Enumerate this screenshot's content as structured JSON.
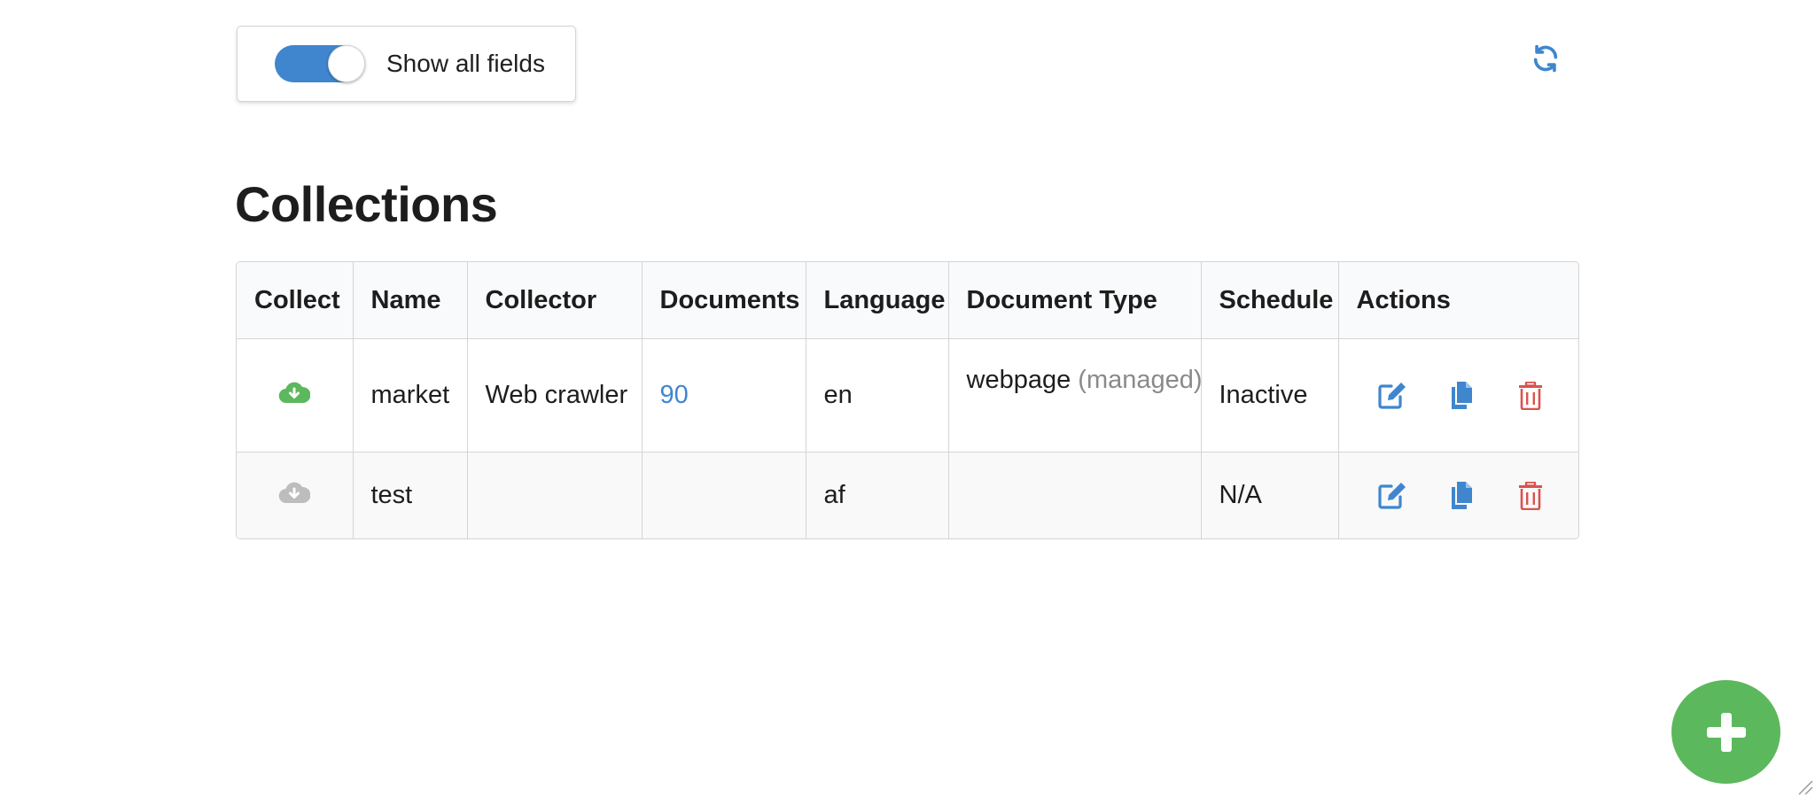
{
  "toggle": {
    "label": "Show all fields",
    "checked": true,
    "accent_color": "#3f86cf"
  },
  "refresh_icon": "refresh-icon",
  "page_title": "Collections",
  "table": {
    "columns": [
      "Collect",
      "Name",
      "Collector",
      "Documents",
      "Language",
      "Document Type",
      "Schedule",
      "Actions"
    ],
    "rows": [
      {
        "collect_icon": "cloud-download-icon",
        "collect_active": true,
        "name": "market",
        "collector": "Web crawler",
        "documents": "90",
        "language": "en",
        "document_type": "webpage",
        "document_type_note": "(managed)",
        "schedule": "Inactive"
      },
      {
        "collect_icon": "cloud-download-icon",
        "collect_active": false,
        "name": "test",
        "collector": "",
        "documents": "",
        "language": "af",
        "document_type": "",
        "document_type_note": "",
        "schedule": "N/A"
      }
    ],
    "actions": [
      "edit-icon",
      "copy-icon",
      "delete-icon"
    ]
  },
  "colors": {
    "primary": "#3f86cf",
    "success": "#5cb85c",
    "danger": "#d9534f",
    "disabled": "#bdbdbd"
  },
  "fab_icon": "plus-icon"
}
